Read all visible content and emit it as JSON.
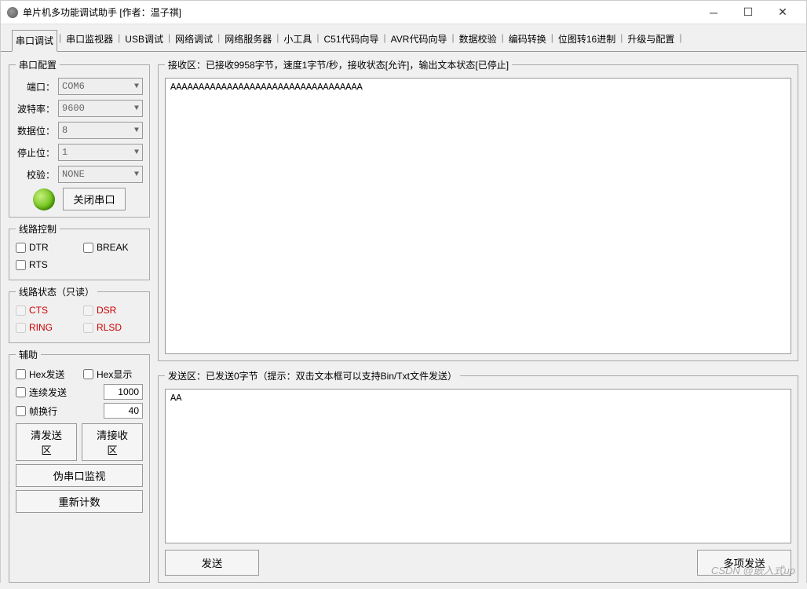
{
  "window": {
    "title": "单片机多功能调试助手 [作者：温子祺]"
  },
  "tabs": [
    "串口调试",
    "串口监视器",
    "USB调试",
    "网络调试",
    "网络服务器",
    "小工具",
    "C51代码向导",
    "AVR代码向导",
    "数据校验",
    "编码转换",
    "位图转16进制",
    "升级与配置"
  ],
  "active_tab": 0,
  "serial_config": {
    "legend": "串口配置",
    "port_label": "端口：",
    "port_value": "COM6",
    "baud_label": "波特率：",
    "baud_value": "9600",
    "data_label": "数据位：",
    "data_value": "8",
    "stop_label": "停止位：",
    "stop_value": "1",
    "parity_label": "校验：",
    "parity_value": "NONE",
    "close_btn": "关闭串口"
  },
  "line_control": {
    "legend": "线路控制",
    "dtr": "DTR",
    "rts": "RTS",
    "break": "BREAK"
  },
  "line_status": {
    "legend": "线路状态（只读）",
    "cts": "CTS",
    "dsr": "DSR",
    "ring": "RING",
    "rlsd": "RLSD"
  },
  "aux": {
    "legend": "辅助",
    "hex_send": "Hex发送",
    "hex_show": "Hex显示",
    "continuous": "连续发送",
    "cont_value": "1000",
    "frame_wrap": "帧换行",
    "frame_value": "40",
    "clear_send": "清发送区",
    "clear_recv": "清接收区",
    "virtual_monitor": "伪串口监视",
    "reset_count": "重新计数"
  },
  "rx": {
    "legend": "接收区：已接收9958字节，速度1字节/秒，接收状态[允许]，输出文本状态[已停止]",
    "content": "AAAAAAAAAAAAAAAAAAAAAAAAAAAAAAAAAA"
  },
  "tx": {
    "legend": "发送区：已发送0字节（提示：双击文本框可以支持Bin/Txt文件发送）",
    "content": "AA",
    "send_btn": "发送",
    "multi_send_btn": "多项发送"
  },
  "watermark": "CSDN @嵌入式up"
}
